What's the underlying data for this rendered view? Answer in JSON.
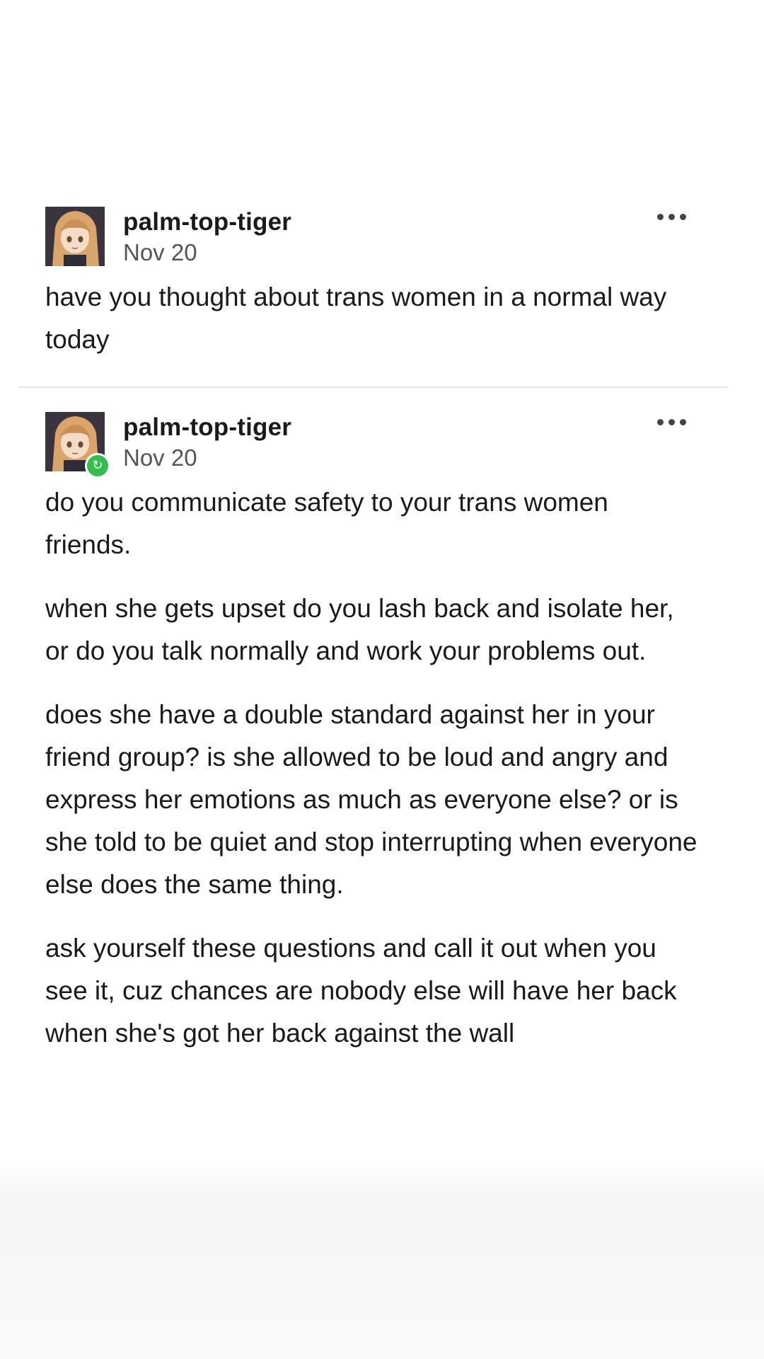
{
  "posts": [
    {
      "username": "palm-top-tiger",
      "date": "Nov 20",
      "avatar_icon": "anime-girl-avatar",
      "reblogged": false,
      "paragraphs": [
        "have you thought about trans women in a normal way today"
      ]
    },
    {
      "username": "palm-top-tiger",
      "date": "Nov 20",
      "avatar_icon": "anime-girl-avatar",
      "reblogged": true,
      "badge_icon": "reblog-icon",
      "paragraphs": [
        "do you communicate safety to your trans women friends.",
        "when she gets upset do you lash back and isolate her, or do you talk normally and work your problems out.",
        "does she have a double standard against her in your friend group? is she allowed to be loud and angry and express her emotions as much as everyone else? or is she told to be quiet and stop interrupting when everyone else does the same thing.",
        "ask yourself these questions and call it out when you see it, cuz chances are nobody else will have her back when she's got her back against the wall"
      ]
    }
  ],
  "colors": {
    "text": "#1a1a1a",
    "date": "#555555",
    "divider": "#e6e6e6",
    "reblog_badge": "#2fbf4a"
  }
}
